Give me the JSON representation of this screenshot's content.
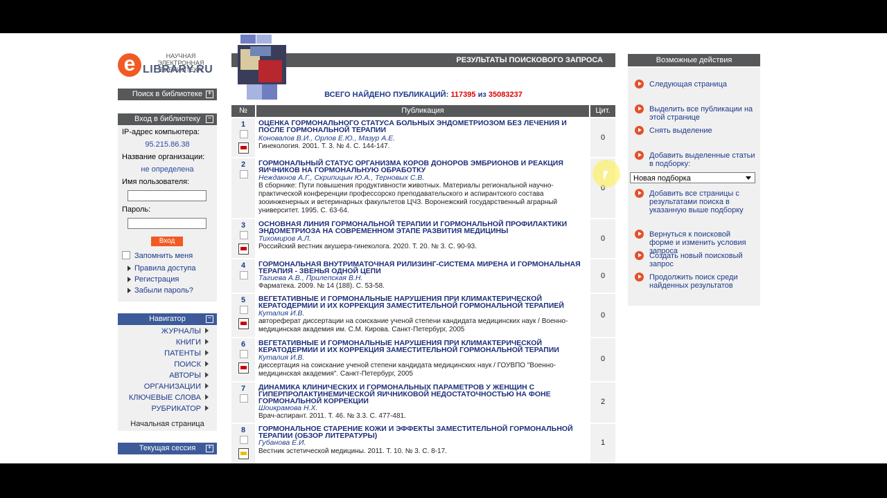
{
  "logo": {
    "letter": "e",
    "tagline": "НАУЧНАЯ ЭЛЕКТРОННАЯ БИБЛИОТЕКА",
    "name": "LIBRARY.RU"
  },
  "left": {
    "search_bar": "Поиск в библиотеке",
    "login_bar": "Вход в библиотеку",
    "ip_label": "IP-адрес компьютера:",
    "ip_value": "95.215.86.38",
    "org_label": "Название организации:",
    "org_value": "не определена",
    "user_label": "Имя пользователя:",
    "pass_label": "Пароль:",
    "enter_btn": "Вход",
    "remember": "Запомнить меня",
    "links": [
      "Правила доступа",
      "Регистрация",
      "Забыли пароль?"
    ],
    "nav_bar": "Навигатор",
    "nav_items": [
      "ЖУРНАЛЫ",
      "КНИГИ",
      "ПАТЕНТЫ",
      "ПОИСК",
      "АВТОРЫ",
      "ОРГАНИЗАЦИИ",
      "КЛЮЧЕВЫЕ СЛОВА",
      "РУБРИКАТОР"
    ],
    "home": "Начальная страница",
    "session_bar": "Текущая сессия"
  },
  "main": {
    "header": "РЕЗУЛЬТАТЫ ПОИСКОВОГО ЗАПРОСА",
    "found_label": "ВСЕГО НАЙДЕНО ПУБЛИКАЦИЙ:",
    "found_count": "117395",
    "found_of": "из",
    "found_total": "35083237",
    "col_num": "№",
    "col_pub": "Публикация",
    "col_cit": "Цит.",
    "rows": [
      {
        "num": "1",
        "title": "ОЦЕНКА ГОРМОНАЛЬНОГО СТАТУСА БОЛЬНЫХ ЭНДОМЕТРИОЗОМ БЕЗ ЛЕЧЕНИЯ И ПОСЛЕ ГОРМОНАЛЬНОЙ ТЕРАПИИ",
        "authors": "Коновалов В.И., Орлов Е.Ю., Мазур А.Е.",
        "source": "Гинекология. 2001. Т. 3. № 4. С. 144-147.",
        "cit": "0"
      },
      {
        "num": "2",
        "title": "ГОРМОНАЛЬНЫЙ СТАТУС ОРГАНИЗМА КОРОВ ДОНОРОВ ЭМБРИОНОВ И РЕАКЦИЯ ЯИЧНИКОВ НА ГОРМОНАЛЬНУЮ ОБРАБОТКУ",
        "authors": "Неждакнов А.Г., Скрипицын Ю.А., Терновых С.В.",
        "source": "В сборнике: Пути повышения продуктивности животных. Материалы региональной научно-практической конференции профессорско преподавательского и аспирантского состава зооинженерных и ветеринарных факультетов ЦЧЗ. Воронежский государственный аграрный университет. 1995. С. 63-64.",
        "cit": "0"
      },
      {
        "num": "3",
        "title": "ОСНОВНАЯ ЛИНИЯ ГОРМОНАЛЬНОЙ ТЕРАПИИ И ГОРМОНАЛЬНОЙ ПРОФИЛАКТИКИ ЭНДОМЕТРИОЗА НА СОВРЕМЕННОМ ЭТАПЕ РАЗВИТИЯ МЕДИЦИНЫ",
        "authors": "Тихомиров А.Л.",
        "source": "Российский вестник акушера-гинеколога. 2020. Т. 20. № 3. С. 90-93.",
        "cit": "0"
      },
      {
        "num": "4",
        "title": "ГОРМОНАЛЬНАЯ ВНУТРИМАТОЧНАЯ РИЛИЗИНГ-СИСТЕМА МИРЕНА И ГОРМОНАЛЬНАЯ ТЕРАПИЯ - ЗВЕНЬЯ ОДНОЙ ЦЕПИ",
        "authors": "Тагиева А.В., Прилепская В.Н.",
        "source": "Фарматека. 2009. № 14 (188). С. 53-58.",
        "cit": "0"
      },
      {
        "num": "5",
        "title": "ВЕГЕТАТИВНЫЕ И ГОРМОНАЛЬНЫЕ НАРУШЕНИЯ ПРИ КЛИМАКТЕРИЧЕСКОЙ КЕРАТОДЕРМИИ И ИХ КОРРЕКЦИЯ ЗАМЕСТИТЕЛЬНОЙ ГОРМОНАЛЬНОЙ ТЕРАПИЕЙ",
        "authors": "Куталия И.В.",
        "source": "автореферат диссертации на соискание ученой степени кандидата медицинских наук / Военно-медицинская академия им. С.М. Кирова. Санкт-Петербург, 2005",
        "cit": "0"
      },
      {
        "num": "6",
        "title": "ВЕГЕТАТИВНЫЕ И ГОРМОНАЛЬНЫЕ НАРУШЕНИЯ ПРИ КЛИМАКТЕРИЧЕСКОЙ КЕРАТОДЕРМИИ И ИХ КОРРЕКЦИЯ ЗАМЕСТИТЕЛЬНОЙ ГОРМОНАЛЬНОЙ ТЕРАПИИ",
        "authors": "Куталия И.В.",
        "source": "диссертация на соискание ученой степени кандидата медицинских наук / ГОУВПО \"Военно-медицинская академия\". Санкт-Петербург, 2005",
        "cit": "0"
      },
      {
        "num": "7",
        "title": "ДИНАМИКА КЛИНИЧЕСКИХ И ГОРМОНАЛЬНЫХ ПАРАМЕТРОВ У ЖЕНЩИН С ГИПЕРПРОЛАКТИНЕМИЧЕСКОЙ ЯИЧНИКОВОЙ НЕДОСТАТОЧНОСТЬЮ НА ФОНЕ ГОРМОНАЛЬНОЙ КОРРЕКЦИИ",
        "authors": "Шоикрамова Н.Х.",
        "source": "Врач-аспирант. 2011. Т. 46. № 3.3. С. 477-481.",
        "cit": "2"
      },
      {
        "num": "8",
        "title": "ГОРМОНАЛЬНОЕ СТАРЕНИЕ КОЖИ И ЭФФЕКТЫ ЗАМЕСТИТЕЛЬНОЙ ГОРМОНАЛЬНОЙ ТЕРАПИИ (ОБЗОР ЛИТЕРАТУРЫ)",
        "authors": "Губанова Е.И.",
        "source": "Вестник эстетической медицины. 2011. Т. 10. № 3. С. 8-17.",
        "cit": "1"
      }
    ]
  },
  "right": {
    "header": "Возможные действия",
    "actions": [
      "Следующая страница",
      "Выделить все публикации на этой странице",
      "Снять выделение",
      "Добавить выделенные статьи в подборку:",
      "Добавить все страницы с результатами поиска в указанную выше подборку",
      "Вернуться к поисковой форме и изменить условия запроса",
      "Создать новый поисковый запрос",
      "Продолжить поиск среди найденных результатов"
    ],
    "select_value": "Новая подборка"
  },
  "colors": {
    "accent": "#f15a24",
    "header_gray": "#56585a",
    "nav_blue": "#3d5a99",
    "link": "#1d3a8a",
    "count_red": "#dd0000"
  }
}
